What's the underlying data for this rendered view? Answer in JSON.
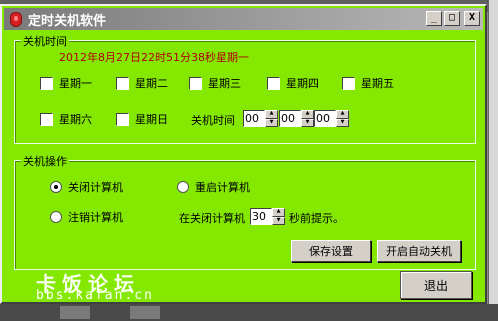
{
  "window": {
    "title": "定时关机软件",
    "controls": {
      "minimize": "_",
      "maximize": "□",
      "close": "X"
    }
  },
  "time_group": {
    "legend": "关机时间",
    "current_datetime": "2012年8月27日22时51分38秒星期一",
    "days": [
      "星期一",
      "星期二",
      "星期三",
      "星期四",
      "星期五",
      "星期六",
      "星期日"
    ],
    "shutdown_time_label": "关机时间",
    "hour": "00",
    "minute": "00",
    "second": "00"
  },
  "action_group": {
    "legend": "关机操作",
    "options": [
      "关闭计算机",
      "重启计算机",
      "注销计算机"
    ],
    "selected_option": "关闭计算机",
    "prompt_prefix": "在关闭计算机",
    "prompt_seconds": "30",
    "prompt_suffix": "秒前提示。",
    "save_button": "保存设置",
    "auto_shutdown_button": "开启自动关机"
  },
  "exit_button": "退出",
  "watermark": {
    "chinese": "卡饭论坛",
    "url": "bbs.kafan.cn"
  },
  "colors": {
    "window_background": "#85e800",
    "datetime_text": "#b00000"
  }
}
